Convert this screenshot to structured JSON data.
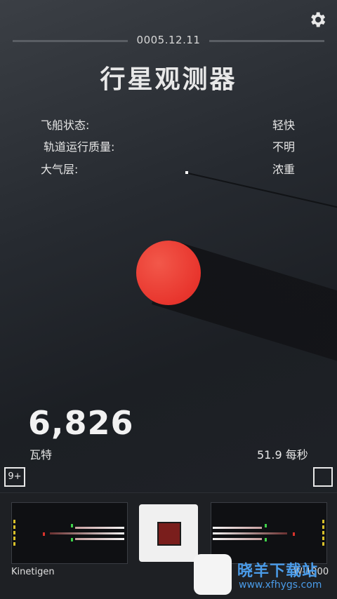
{
  "header": {
    "date": "0005.12.11",
    "title": "行星观测器"
  },
  "stats": [
    {
      "label": "飞船状态:",
      "value": "轻快"
    },
    {
      "label": "轨道运行质量:",
      "value": "不明"
    },
    {
      "label": "大气层:",
      "value": "浓重"
    }
  ],
  "power": {
    "value": "6,826",
    "unit": "瓦特",
    "rate": "51.9 每秒"
  },
  "badge": "9+",
  "bottom": {
    "left_name": "Kinetigen",
    "right_name": "W-1000"
  },
  "watermark": {
    "main": "晓羊下载站",
    "url": "www.xfhygs.com"
  },
  "colors": {
    "planet": "#e8352d",
    "accent_green": "#3fd14a",
    "meter_yellow": "#d8c02a"
  },
  "icons": {
    "settings": "gear-icon",
    "stop": "stop-square-icon"
  }
}
